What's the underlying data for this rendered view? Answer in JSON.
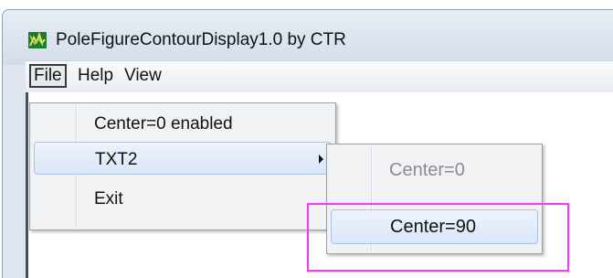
{
  "window": {
    "title": "PoleFigureContourDisplay1.0 by CTR",
    "icon": "app-chart-icon"
  },
  "menubar": {
    "file": "File",
    "help": "Help",
    "view": "View"
  },
  "file_menu": {
    "items": [
      {
        "label": "Center=0 enabled"
      },
      {
        "label": "TXT2"
      },
      {
        "label": "Exit"
      }
    ]
  },
  "txt2_submenu": {
    "items": [
      {
        "label": "Center=0",
        "state": "disabled"
      },
      {
        "label": "Center=90",
        "state": "highlighted"
      }
    ]
  },
  "annotation": {
    "color": "#ff33ff"
  }
}
